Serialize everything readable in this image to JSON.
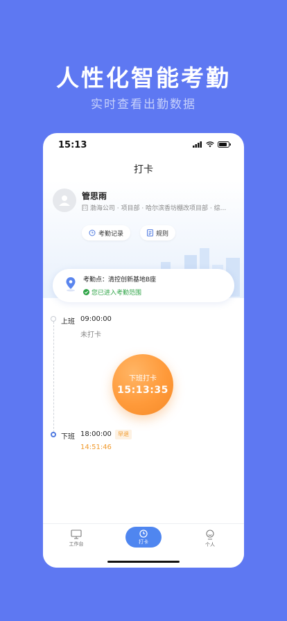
{
  "hero": {
    "title": "人性化智能考勤",
    "subtitle": "实时查看出勤数据"
  },
  "status_bar": {
    "time": "15:13"
  },
  "nav": {
    "title": "打卡"
  },
  "user": {
    "name": "管思雨",
    "org": "渤海公司 · 项目部 · 哈尔滨香坊棚改项目部 · 综..."
  },
  "actions": {
    "records_label": "考勤记录",
    "rules_label": "规则"
  },
  "location": {
    "name": "考勤点：清控创新基地B座",
    "status": "您已进入考勤范围"
  },
  "timeline": {
    "start": {
      "label": "上班",
      "time": "09:00:00",
      "note": "未打卡"
    },
    "end": {
      "label": "下班",
      "time": "18:00:00",
      "tag": "早退",
      "punched": "14:51:46"
    }
  },
  "clock_button": {
    "label": "下班打卡",
    "time": "15:13:35"
  },
  "tabbar": {
    "work": "工作台",
    "clock": "打卡",
    "me": "个人"
  },
  "colors": {
    "background": "#5e78f2",
    "accent": "#4f86f0",
    "orange": "#ff9a3a",
    "success": "#2fa447"
  }
}
